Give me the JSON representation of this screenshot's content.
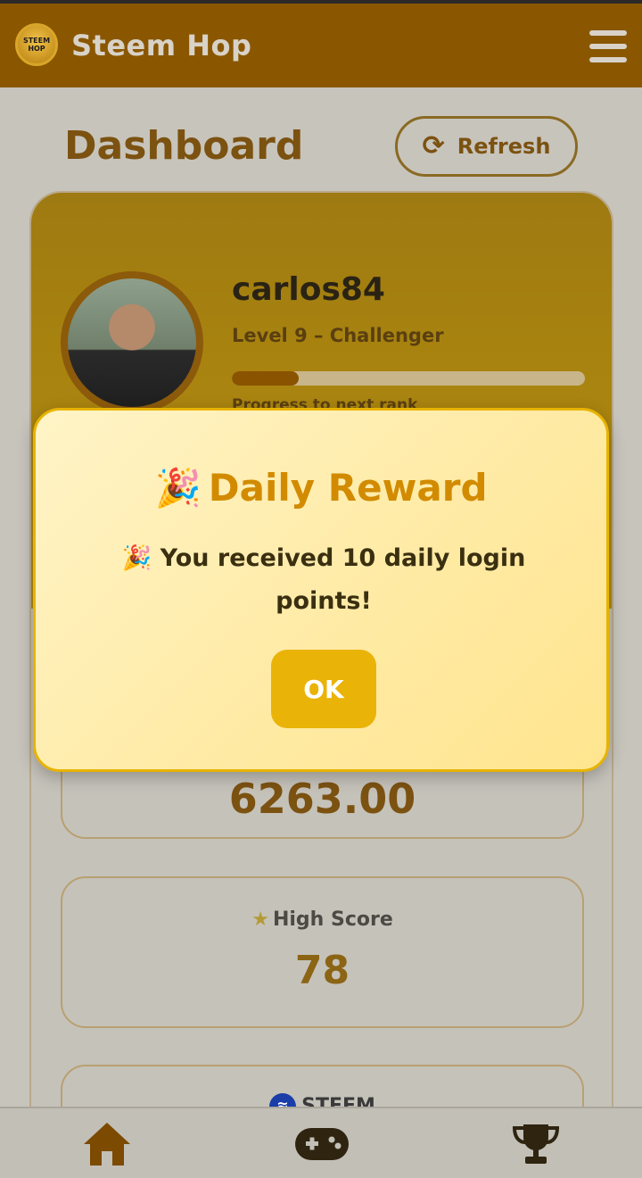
{
  "app": {
    "title": "Steem Hop",
    "logo_line1": "STEEM",
    "logo_line2": "HOP"
  },
  "header": {
    "page_title": "Dashboard",
    "refresh_label": "Refresh",
    "refresh_icon": "refresh-icon",
    "menu_icon": "hamburger-menu-icon"
  },
  "profile": {
    "username": "carlos84",
    "level": "Level 9 – Challenger",
    "progress_fraction": 0.19,
    "progress_label": "Progress to next rank"
  },
  "stats": {
    "points_value": "6263.00",
    "high_score_label": "High Score",
    "high_score_value": "78",
    "steem_label": "STEEM"
  },
  "modal": {
    "title_emoji": "🎉",
    "title": "Daily Reward",
    "message": "🎉 You received 10 daily login points!",
    "ok_label": "OK"
  },
  "nav": {
    "items": [
      {
        "icon": "home-icon"
      },
      {
        "icon": "gamepad-icon"
      },
      {
        "icon": "trophy-icon"
      }
    ]
  },
  "colors": {
    "header_bg": "#8a5700",
    "accent": "#eab308",
    "modal_title": "#d28b00",
    "nav_icon": "#7c4a00"
  }
}
